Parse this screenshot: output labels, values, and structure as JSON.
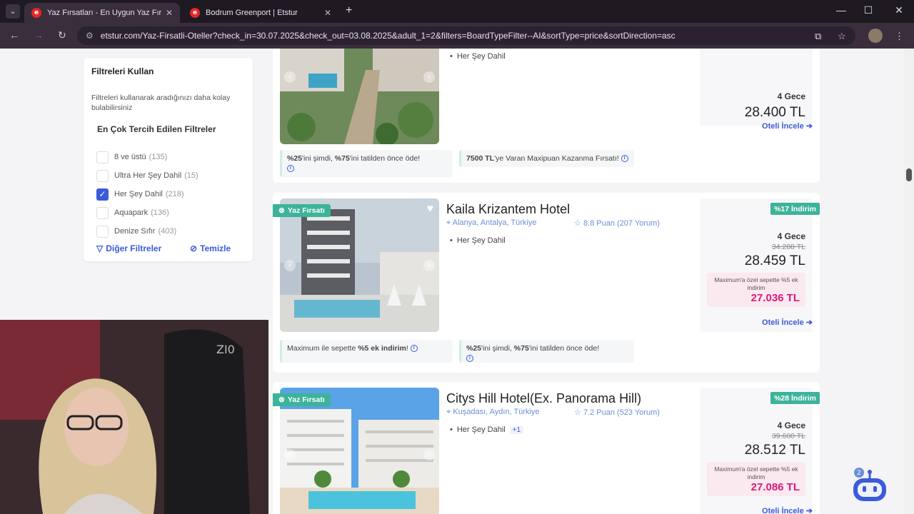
{
  "browser": {
    "tabs": [
      {
        "title": "Yaz Fırsatları - En Uygun Yaz Fır",
        "active": true
      },
      {
        "title": "Bodrum Greenport | Etstur",
        "active": false
      }
    ],
    "url": "etstur.com/Yaz-Firsatli-Oteller?check_in=30.07.2025&check_out=03.08.2025&adult_1=2&filters=BoardTypeFilter--AI&sortType=price&sortDirection=asc"
  },
  "filters": {
    "title": "Filtreleri Kullan",
    "description": "Filtreleri kullanarak aradığınızı daha kolay bulabilirsiniz",
    "subtitle": "En Çok Tercih Edilen Filtreler",
    "options": [
      {
        "label": "8 ve üstü",
        "count": "(135)",
        "checked": false
      },
      {
        "label": "Ultra Her Şey Dahil",
        "count": "(15)",
        "checked": false
      },
      {
        "label": "Her Şey Dahil",
        "count": "(218)",
        "checked": true
      },
      {
        "label": "Aquapark",
        "count": "(136)",
        "checked": false
      },
      {
        "label": "Denize Sıfır",
        "count": "(403)",
        "checked": false
      }
    ],
    "other_label": "Diğer Filtreler",
    "clear_label": "Temizle"
  },
  "hotels": [
    {
      "board": "Her Şey Dahil",
      "nights": "4 Gece",
      "price": "28.400 TL",
      "link": "Oteli İncele",
      "promos": [
        {
          "bold1": "%25",
          "text1": "'ini şimdi, ",
          "bold2": "%75",
          "text2": "'ini tatilden önce öde!"
        },
        {
          "bold1": "7500 TL",
          "text1": "'ye Varan Maxipuan Kazanma Fırsatı!"
        }
      ]
    },
    {
      "badge": "Yaz Fırsatı",
      "name": "Kaila Krizantem Hotel",
      "location": "Alanya, Antalya, Türkiye",
      "rating": "8.8 Puan (207 Yorum)",
      "board": "Her Şey Dahil",
      "discount": "%17 İndirim",
      "nights": "4 Gece",
      "old_price": "34.288 TL",
      "price": "28.459 TL",
      "special_text": "Maximum'a özel sepette %5 ek indirim",
      "special_price": "27.036 TL",
      "link": "Oteli İncele",
      "promos": [
        {
          "text1": "Maximum ile sepette ",
          "bold1": "%5 ek indirim",
          "text2": "!"
        },
        {
          "bold1": "%25",
          "text1": "'ini şimdi, ",
          "bold2": "%75",
          "text2": "'ini tatilden önce öde!"
        }
      ]
    },
    {
      "badge": "Yaz Fırsatı",
      "name": "Citys Hill Hotel(Ex. Panorama Hill)",
      "location": "Kuşadası, Aydın, Türkiye",
      "rating": "7.2 Puan (523 Yorum)",
      "board": "Her Şey Dahil",
      "board_extra": "+1",
      "discount": "%28 İndirim",
      "nights": "4 Gece",
      "old_price": "39.600 TL",
      "price": "28.512 TL",
      "special_text": "Maximum'a özel sepette %5 ek indirim",
      "special_price": "27.086 TL",
      "link": "Oteli İncele"
    }
  ],
  "chatbot": {
    "badge": "2"
  },
  "webcam": {
    "chair_brand": "ZI0"
  },
  "colors": {
    "accent": "#3b5bdb",
    "green": "#3cb39a",
    "pink": "#d81b7a"
  }
}
